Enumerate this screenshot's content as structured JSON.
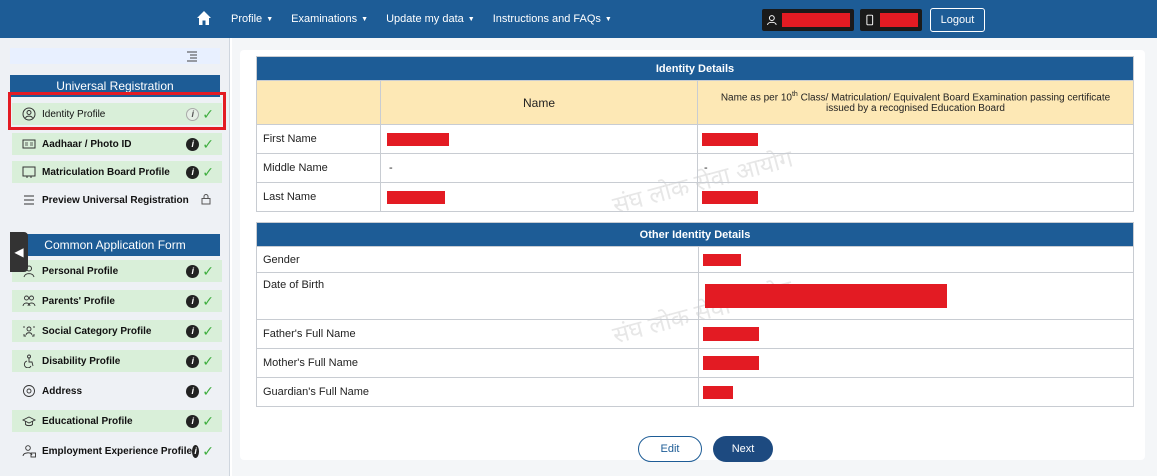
{
  "topbar": {
    "nav": [
      {
        "label": "Profile"
      },
      {
        "label": "Examinations"
      },
      {
        "label": "Update my data"
      },
      {
        "label": "Instructions and FAQs"
      }
    ],
    "logout_label": "Logout"
  },
  "sidebar": {
    "universal_heading": "Universal Registration",
    "universal_items": [
      {
        "label": "Identity Profile",
        "icon": "user-circle-icon"
      },
      {
        "label": "Aadhaar / Photo ID",
        "icon": "id-card-icon"
      },
      {
        "label": "Matriculation Board Profile",
        "icon": "certificate-icon"
      },
      {
        "label": "Preview Universal Registration",
        "icon": "list-icon"
      }
    ],
    "caf_heading": "Common Application Form",
    "caf_items": [
      {
        "label": "Personal Profile",
        "icon": "person-icon"
      },
      {
        "label": "Parents' Profile",
        "icon": "parents-icon"
      },
      {
        "label": "Social Category Profile",
        "icon": "group-icon"
      },
      {
        "label": "Disability Profile",
        "icon": "disability-icon"
      },
      {
        "label": "Address",
        "icon": "location-icon"
      },
      {
        "label": "Educational Profile",
        "icon": "graduation-cap-icon"
      },
      {
        "label": "Employment Experience Profile",
        "icon": "employee-icon"
      }
    ]
  },
  "identity": {
    "heading": "Identity Details",
    "col_name": "Name",
    "col_cert_pre": "Name as per 10",
    "col_cert_sup": "th",
    "col_cert_post": " Class/ Matriculation/ Equivalent Board Examination passing certificate issued by a recognised Education Board",
    "rows": [
      {
        "label": "First Name",
        "name": "",
        "cert": ""
      },
      {
        "label": "Middle Name",
        "name": "-",
        "cert": "-"
      },
      {
        "label": "Last Name",
        "name": "",
        "cert": ""
      }
    ]
  },
  "other": {
    "heading": "Other Identity Details",
    "rows": [
      {
        "label": "Gender"
      },
      {
        "label": "Date of Birth"
      },
      {
        "label": "Father's Full Name"
      },
      {
        "label": "Mother's Full Name"
      },
      {
        "label": "Guardian's Full Name"
      }
    ]
  },
  "actions": {
    "edit_label": "Edit",
    "next_label": "Next"
  },
  "colors": {
    "primary": "#1d5c96",
    "header_cell": "#fde8b5",
    "complete_item": "#d9efd9",
    "redaction": "#e31b23",
    "highlight": "#e31b23"
  }
}
